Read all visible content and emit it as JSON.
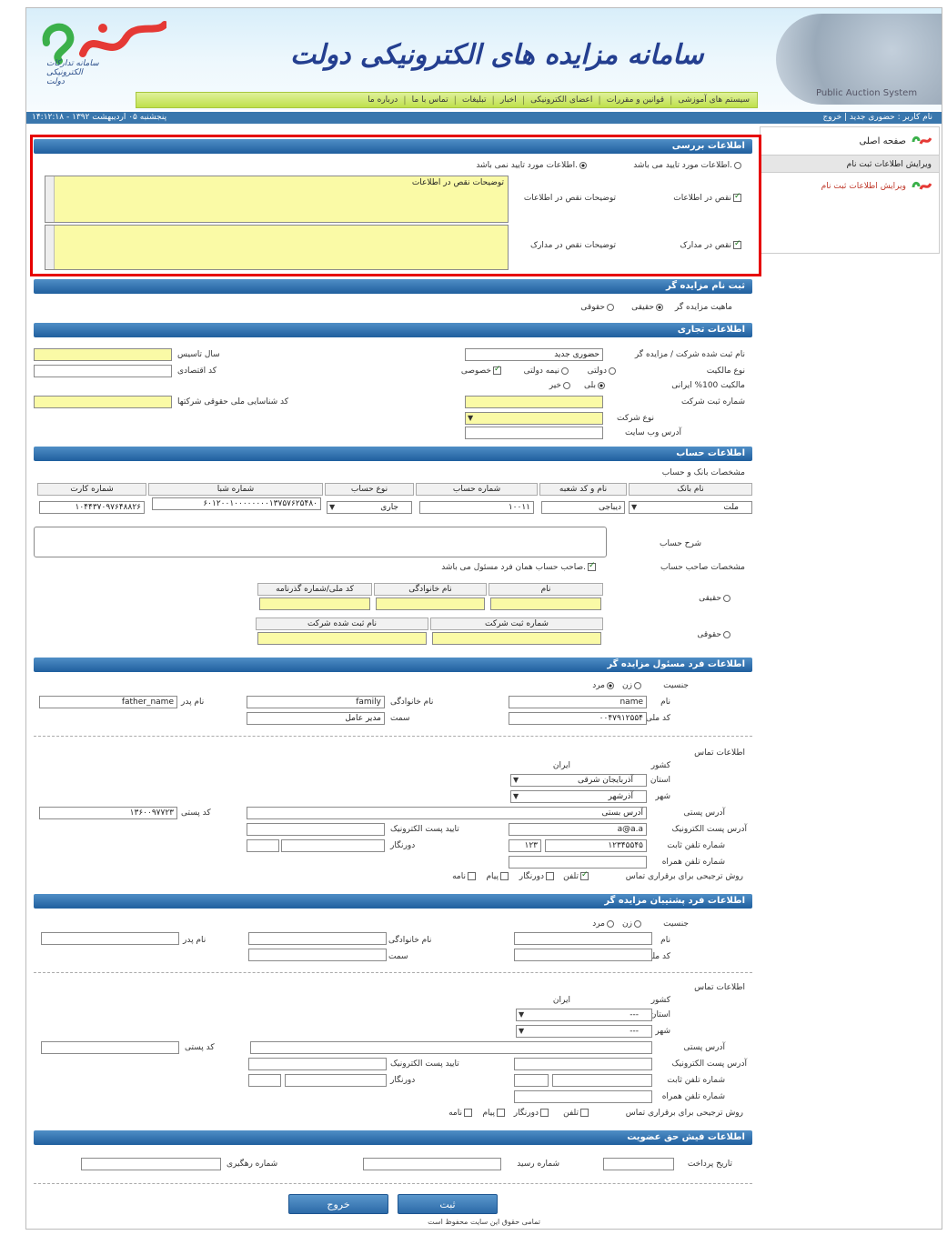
{
  "header": {
    "site_title": "سامانه مزایده های الکترونیکی دولت",
    "logo_caption": "سامانه تدارکات الکترونیکی دولت",
    "globe_text": "Public Auction System",
    "nav": [
      "سامانه تدارکات الکترونیکی دولت"
    ],
    "nav_items": [
      "سیستم های آموزشی",
      "قوانین و مقررات",
      "اعضای الکترونیکی",
      "اخبار",
      "تبلیغات",
      "تماس با ما",
      "درباره ما"
    ]
  },
  "status": {
    "user": "نام کاربر : حضوری جدید | خروج",
    "date": "پنجشنبه ۰۵ اردیبهشت ۱۳۹۲ - ۱۴:۱۲:۱۸"
  },
  "sidebar": {
    "home": "صفحه اصلی",
    "section_header": "ویرایش اطلاعات ثبت نام",
    "link": "ویرایش اطلاعات ثبت نام"
  },
  "review": {
    "title": "اطلاعات بررسی",
    "opt_approved": "اطلاعات مورد تایید می باشد.",
    "opt_not_approved": "اطلاعات مورد تایید نمی باشد.",
    "info_defect": "نقص در اطلاعات",
    "info_defect_desc": "توضیحات نقص در اطلاعات",
    "info_defect_text": "توضیحات نقص در اطلاعات",
    "doc_defect": "نقص در مدارک",
    "doc_defect_desc": "توضیحات نقص در مدارک"
  },
  "registration": {
    "title": "ثبت نام مزایده گر",
    "nature_label": "ماهیت مزایده گر",
    "real": "حقیقی",
    "legal": "حقوقی"
  },
  "trade": {
    "title": "اطلاعات تجاری",
    "company_name_label": "نام ثبت شده شرکت / مزایده گر",
    "company_name_value": "حضوری جدید",
    "establish_date": "سال تاسیس",
    "economic_code": "کد اقتصادی",
    "ownership_label": "نوع مالکیت",
    "ownership_opts": [
      "دولتی",
      "نیمه دولتی",
      "خصوصی"
    ],
    "iranian_label": "مالکیت 100% ایرانی",
    "yes": "بلی",
    "no": "خیر",
    "reg_no": "شماره ثبت شرکت",
    "national_id": "کد شناسایی ملی حقوقی شرکتها",
    "company_type": "نوع شرکت",
    "website": "آدرس وب سایت"
  },
  "account": {
    "title": "اطلاعات حساب",
    "bank_spec": "مشخصات بانک و حساب",
    "headers": [
      "نام بانک",
      "نام و کد شعبه",
      "شماره حساب",
      "نوع حساب",
      "شماره شبا",
      "شماره کارت"
    ],
    "bank": "ملت",
    "branch": "دیباجی",
    "acc_no": "۱۰۰۱۱",
    "acc_type": "جاری",
    "sheba": "۶۰۱۲۰۰۱۰۰۰۰۰۰۰۰۱۳۷۵۷۶۲۵۴۸۰",
    "card": "۱۰۴۴۳۷۰۹۷۶۴۸۸۲۶",
    "desc_label": "شرح حساب",
    "owner_label": "مشخصات صاحب حساب",
    "owner_check": "صاحب حساب همان فرد مسئول می باشد.",
    "real": "حقیقی",
    "legal": "حقوقی",
    "real_headers": [
      "نام",
      "نام خانوادگی",
      "کد ملی/شماره گذرنامه"
    ],
    "legal_headers": [
      "شماره ثبت شرکت",
      "نام ثبت شده شرکت"
    ]
  },
  "responsible": {
    "title": "اطلاعات فرد مسئول مزایده گر",
    "gender": "جنسیت",
    "male": "زن",
    "female": "مرد",
    "first_name": "نام",
    "first_name_value": "name",
    "last_name": "نام خانوادگی",
    "last_name_value": "family",
    "father": "نام پدر",
    "father_value": "father_name",
    "national_code": "کد ملی",
    "national_code_value": "۰۰۴۷۹۱۲۵۵۴",
    "position": "سمت",
    "position_value": "مدیر عامل",
    "contact_title": "اطلاعات تماس",
    "country": "کشور",
    "country_value": "ایران",
    "province": "استان",
    "province_value": "آذربایجان شرقی",
    "city": "شهر",
    "city_value": "آذرشهر",
    "address": "آدرس پستی",
    "address_value": "آدرس بستی",
    "postal": "کد پستی",
    "postal_value": "۱۳۶۰۰۹۷۷۲۳",
    "email": "آدرس پست الکترونیک",
    "email_value": "a@a.a",
    "email_confirm": "تایید پست الکترونیک",
    "phone": "شماره تلفن ثابت",
    "phone_value": "۱۲۳۴۵۵۴۵",
    "phone_code": "۱۲۳",
    "fax": "دورنگار",
    "mobile": "شماره تلفن همراه",
    "pref": "روش ترجیحی برای برقراری تماس",
    "pref_opts": [
      "تلفن",
      "دورنگار",
      "پیام",
      "نامه"
    ]
  },
  "backup": {
    "title": "اطلاعات فرد پشتیبان مزایده گر",
    "gender": "جنسیت",
    "male": "زن",
    "female": "مرد",
    "first_name": "نام",
    "last_name": "نام خانوادگی",
    "father": "نام پدر",
    "national_code": "کد ملی",
    "position": "سمت",
    "contact_title": "اطلاعات تماس",
    "country": "کشور",
    "country_value": "ایران",
    "province": "استان",
    "city": "شهر",
    "dash": "---",
    "address": "آدرس پستی",
    "postal": "کد پستی",
    "email": "آدرس پست الکترونیک",
    "email_confirm": "تایید پست الکترونیک",
    "phone": "شماره تلفن ثابت",
    "fax": "دورنگار",
    "mobile": "شماره تلفن همراه",
    "pref": "روش ترجیحی برای برقراری تماس",
    "pref_opts": [
      "تلفن",
      "دورنگار",
      "پیام",
      "نامه"
    ]
  },
  "fee": {
    "title": "اطلاعات فیش حق عضویت",
    "pay_date": "تاریخ پرداخت",
    "receipt": "شماره رسید",
    "tracking": "شماره رهگیری"
  },
  "buttons": {
    "submit": "ثبت",
    "exit": "خروج"
  },
  "footer": "تمامی حقوق این سایت محفوظ است"
}
